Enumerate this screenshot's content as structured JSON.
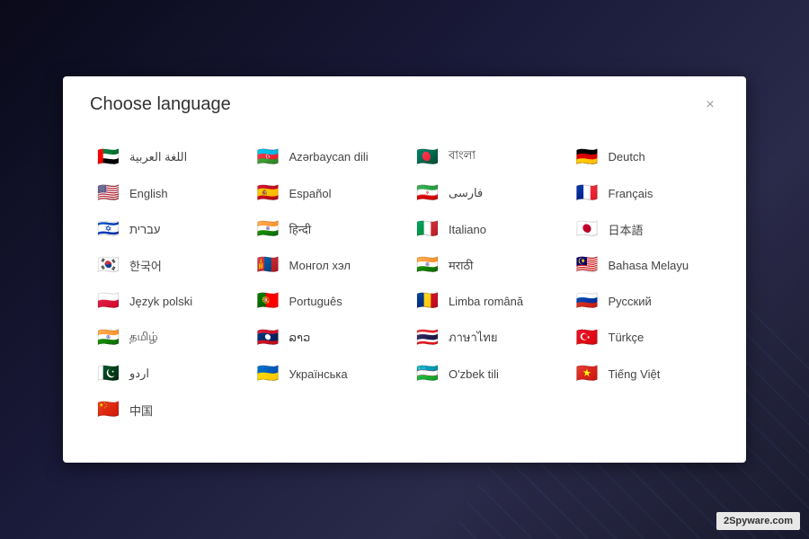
{
  "dialog": {
    "title": "Choose language",
    "close_label": "×"
  },
  "watermark": "2Spyware.com",
  "languages": [
    {
      "name": "اللغة العربية",
      "flag": "🇦🇪",
      "id": "arabic"
    },
    {
      "name": "Azərbaycan dili",
      "flag": "🇦🇿",
      "id": "azerbaijani"
    },
    {
      "name": "বাংলা",
      "flag": "🇧🇩",
      "id": "bengali"
    },
    {
      "name": "Deutch",
      "flag": "🇩🇪",
      "id": "german"
    },
    {
      "name": "English",
      "flag": "🇺🇸",
      "id": "english"
    },
    {
      "name": "Español",
      "flag": "🇪🇸",
      "id": "spanish"
    },
    {
      "name": "فارسی",
      "flag": "🇮🇷",
      "id": "persian"
    },
    {
      "name": "Français",
      "flag": "🇫🇷",
      "id": "french"
    },
    {
      "name": "עברית",
      "flag": "🇮🇱",
      "id": "hebrew"
    },
    {
      "name": "हिन्दी",
      "flag": "🇮🇳",
      "id": "hindi"
    },
    {
      "name": "Italiano",
      "flag": "🇮🇹",
      "id": "italian"
    },
    {
      "name": "日本語",
      "flag": "🇯🇵",
      "id": "japanese"
    },
    {
      "name": "한국어",
      "flag": "🇰🇷",
      "id": "korean"
    },
    {
      "name": "Монгол хэл",
      "flag": "🇲🇳",
      "id": "mongolian"
    },
    {
      "name": "मराठी",
      "flag": "🇮🇳",
      "id": "marathi"
    },
    {
      "name": "Bahasa Melayu",
      "flag": "🇲🇾",
      "id": "malay"
    },
    {
      "name": "Język polski",
      "flag": "🇵🇱",
      "id": "polish"
    },
    {
      "name": "Português",
      "flag": "🇵🇹",
      "id": "portuguese"
    },
    {
      "name": "Limba română",
      "flag": "🇷🇴",
      "id": "romanian"
    },
    {
      "name": "Русский",
      "flag": "🇷🇺",
      "id": "russian"
    },
    {
      "name": "தமிழ்",
      "flag": "🇮🇳",
      "id": "tamil"
    },
    {
      "name": "ລາວ",
      "flag": "🇱🇦",
      "id": "lao"
    },
    {
      "name": "ภาษาไทย",
      "flag": "🇹🇭",
      "id": "thai"
    },
    {
      "name": "Türkçe",
      "flag": "🇹🇷",
      "id": "turkish"
    },
    {
      "name": "اردو",
      "flag": "🇵🇰",
      "id": "urdu"
    },
    {
      "name": "Українська",
      "flag": "🇺🇦",
      "id": "ukrainian"
    },
    {
      "name": "O'zbek tili",
      "flag": "🇺🇿",
      "id": "uzbek"
    },
    {
      "name": "Tiếng Việt",
      "flag": "🇻🇳",
      "id": "vietnamese"
    },
    {
      "name": "中国",
      "flag": "🇨🇳",
      "id": "chinese"
    }
  ]
}
